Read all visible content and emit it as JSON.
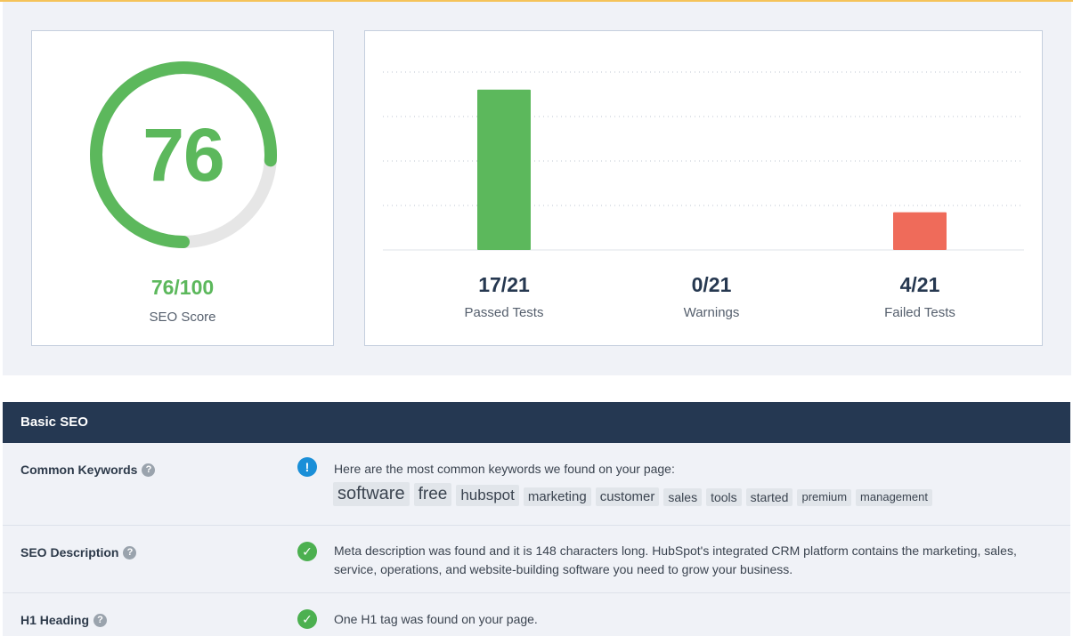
{
  "score": {
    "value": "76",
    "percent": 76,
    "fraction": "76/100",
    "caption": "SEO Score",
    "color": "#5cb85c",
    "track_color": "#e6e6e6"
  },
  "tests": {
    "passed": {
      "value": "17/21",
      "label": "Passed Tests",
      "count": 17
    },
    "warnings": {
      "value": "0/21",
      "label": "Warnings",
      "count": 0
    },
    "failed": {
      "value": "4/21",
      "label": "Failed Tests",
      "count": 4
    },
    "total": 21
  },
  "chart_data": {
    "type": "bar",
    "categories": [
      "Passed Tests",
      "Warnings",
      "Failed Tests"
    ],
    "values": [
      17,
      0,
      4
    ],
    "colors": [
      "#5cb85c",
      "#f0ad4e",
      "#ef6b5a"
    ],
    "ylim": [
      0,
      20
    ],
    "grid": true
  },
  "section": {
    "title": "Basic SEO"
  },
  "rows": [
    {
      "label": "Common Keywords",
      "status": "info",
      "text": "Here are the most common keywords we found on your page:",
      "keywords": [
        "software",
        "free",
        "hubspot",
        "marketing",
        "customer",
        "sales",
        "tools",
        "started",
        "premium",
        "management"
      ]
    },
    {
      "label": "SEO Description",
      "status": "ok",
      "text": "Meta description was found and it is 148 characters long. HubSpot's integrated CRM platform contains the marketing, sales, service, operations, and website-building software you need to grow your business."
    },
    {
      "label": "H1 Heading",
      "status": "ok",
      "text": "One H1 tag was found on your page."
    }
  ],
  "icons": {
    "help": "?",
    "ok": "✓",
    "info": "!"
  }
}
